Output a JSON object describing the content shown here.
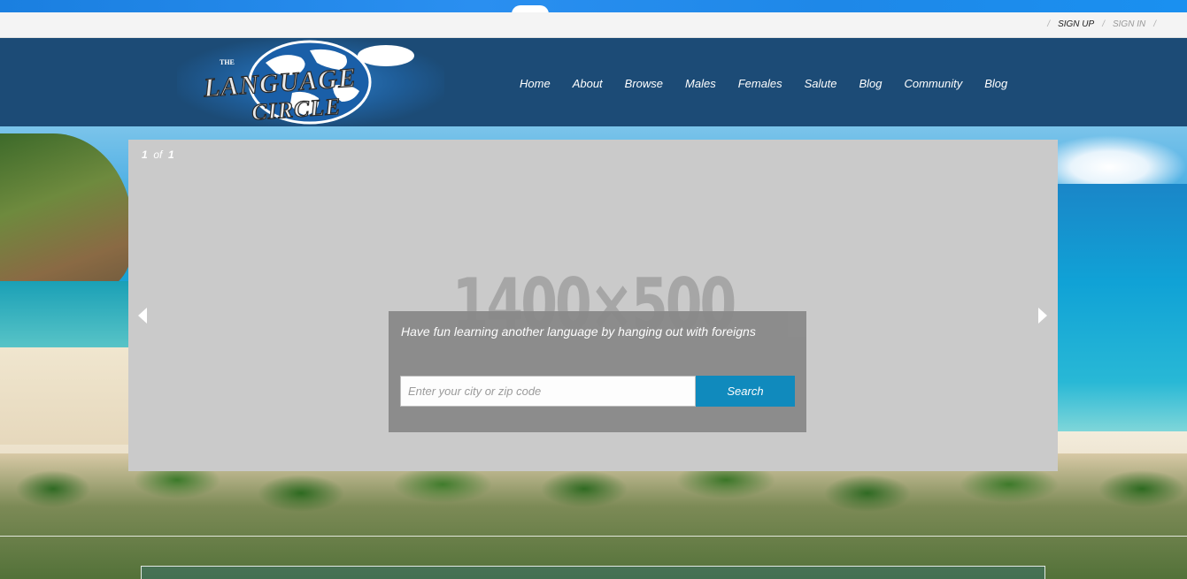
{
  "utility": {
    "separator": "/",
    "sign_up": "SIGN UP",
    "sign_in": "SIGN IN"
  },
  "logo": {
    "small_text": "THE",
    "line1": "LANGUAGE",
    "line2": "CIRCLE"
  },
  "nav": {
    "items": [
      "Home",
      "About",
      "Browse",
      "Males",
      "Females",
      "Salute",
      "Blog",
      "Community",
      "Blog"
    ]
  },
  "slider": {
    "current": "1",
    "of_label": "of",
    "total": "1",
    "placeholder": "1400×500"
  },
  "search": {
    "tagline": "Have fun learning another language by hanging out with foreigns",
    "input_placeholder": "Enter your city or zip code",
    "input_value": "",
    "button_label": "Search"
  },
  "colors": {
    "header_bg": "#1c4b76",
    "search_button": "#0b88bd",
    "slider_bg": "#cacaca"
  }
}
